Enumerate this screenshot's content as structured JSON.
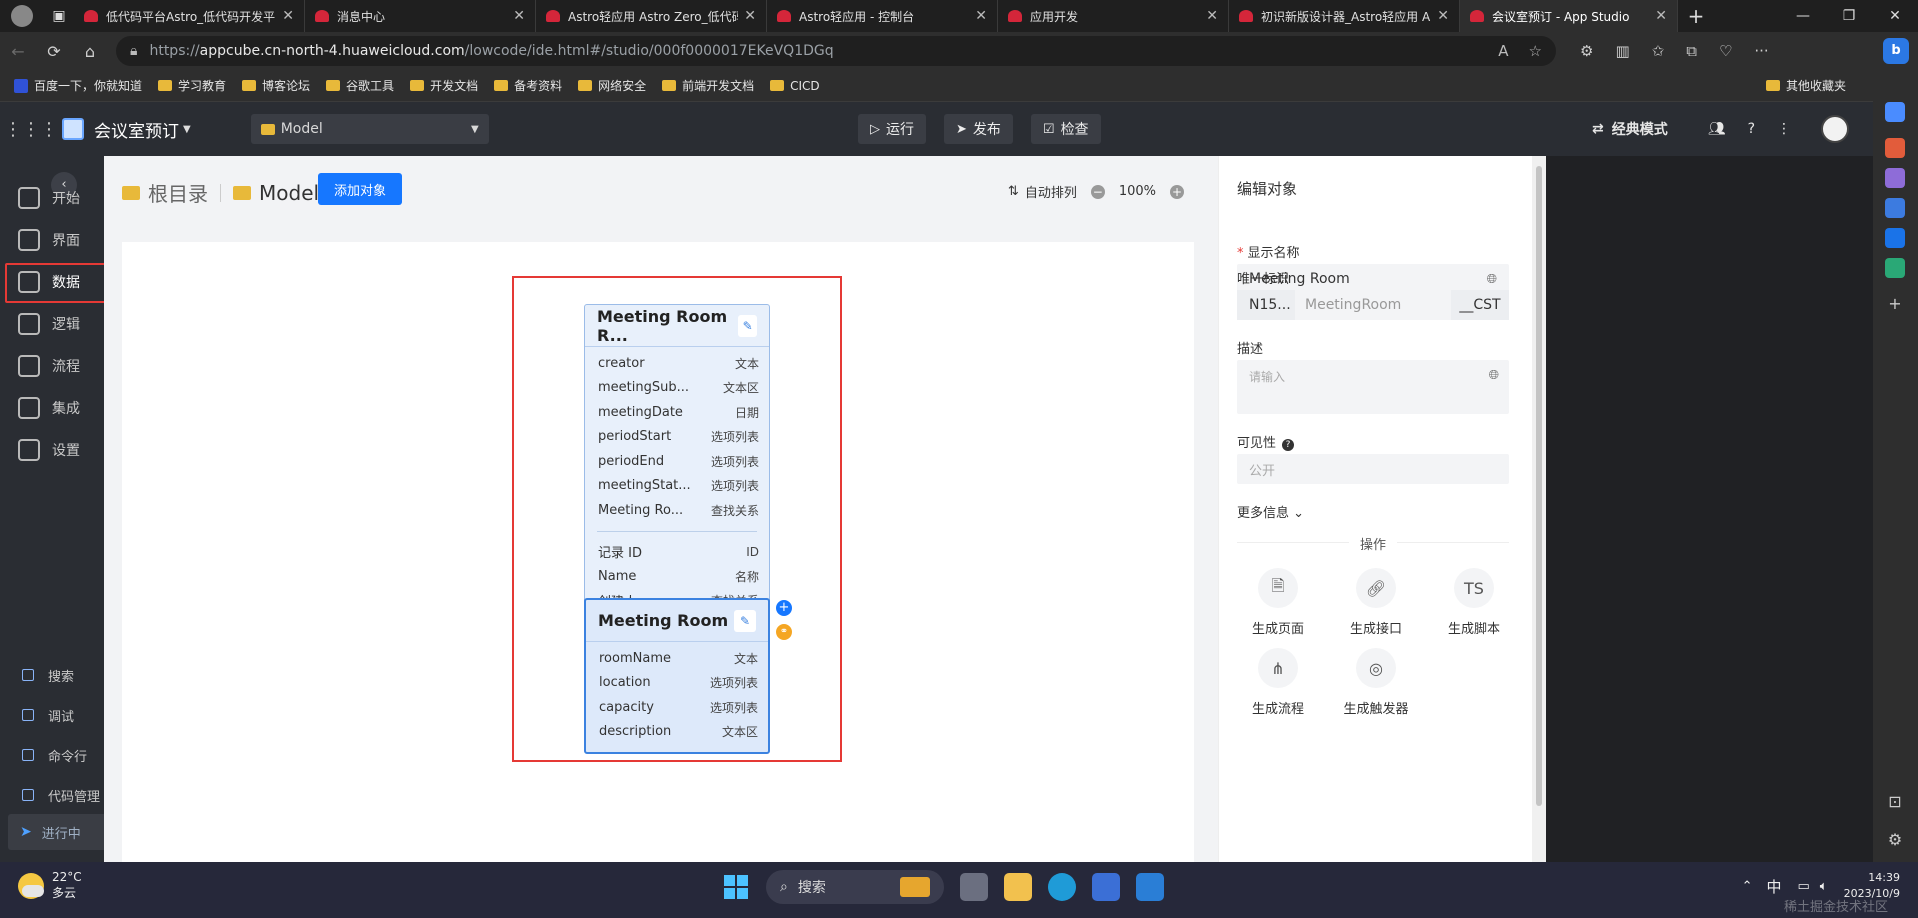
{
  "browser": {
    "tabs": [
      {
        "title": "低代码平台Astro_低代码开发平"
      },
      {
        "title": "消息中心"
      },
      {
        "title": "Astro轻应用 Astro Zero_低代码"
      },
      {
        "title": "Astro轻应用 - 控制台"
      },
      {
        "title": "应用开发"
      },
      {
        "title": "初识新版设计器_Astro轻应用 A"
      },
      {
        "title": "会议室预订 - App Studio"
      }
    ],
    "url_prefix": "https://",
    "url_host": "appcube.cn-north-4.huaweicloud.com",
    "url_path": "/lowcode/ide.html#/studio/000f0000017EKeVQ1DGq",
    "bookmarks": [
      "百度一下，你就知道",
      "学习教育",
      "博客论坛",
      "谷歌工具",
      "开发文档",
      "备考资料",
      "网络安全",
      "前端开发文档",
      "CICD"
    ],
    "bookmark_right": "其他收藏夹"
  },
  "app": {
    "name": "会议室预订",
    "model_select": "Model",
    "run_label": "运行",
    "publish_label": "发布",
    "check_label": "检查",
    "mode_label": "经典模式"
  },
  "sidebar": {
    "items": [
      {
        "label": "开始"
      },
      {
        "label": "界面"
      },
      {
        "label": "数据"
      },
      {
        "label": "逻辑"
      },
      {
        "label": "流程"
      },
      {
        "label": "集成"
      },
      {
        "label": "设置"
      }
    ],
    "tools": [
      {
        "label": "搜索"
      },
      {
        "label": "调试"
      },
      {
        "label": "命令行"
      },
      {
        "label": "代码管理"
      }
    ],
    "running_label": "进行中"
  },
  "canvas": {
    "breadcrumb_root": "根目录",
    "breadcrumb_current": "Model",
    "add_object_label": "添加对象",
    "auto_arrange_label": "自动排列",
    "zoom_level": "100%"
  },
  "entities": [
    {
      "title": "Meeting Room R...",
      "fields": [
        {
          "name": "creator",
          "type": "文本"
        },
        {
          "name": "meetingSub...",
          "type": "文本区"
        },
        {
          "name": "meetingDate",
          "type": "日期"
        },
        {
          "name": "periodStart",
          "type": "选项列表"
        },
        {
          "name": "periodEnd",
          "type": "选项列表"
        },
        {
          "name": "meetingStat...",
          "type": "选项列表"
        },
        {
          "name": "Meeting Ro...",
          "type": "查找关系"
        }
      ],
      "system_fields": [
        {
          "name": "记录 ID",
          "type": "ID"
        },
        {
          "name": "Name",
          "type": "名称"
        },
        {
          "name": "创建人",
          "type": "查找关系"
        }
      ]
    },
    {
      "title": "Meeting Room",
      "fields": [
        {
          "name": "roomName",
          "type": "文本"
        },
        {
          "name": "location",
          "type": "选项列表"
        },
        {
          "name": "capacity",
          "type": "选项列表"
        },
        {
          "name": "description",
          "type": "文本区"
        }
      ]
    }
  ],
  "panel": {
    "title": "编辑对象",
    "display_name_label": "显示名称",
    "display_name_value": "Meeting Room",
    "unique_id_label": "唯一标识",
    "unique_id_prefix": "N15...",
    "unique_id_placeholder": "MeetingRoom",
    "unique_id_suffix": "__CST",
    "description_label": "描述",
    "description_placeholder": "请输入",
    "visibility_label": "可见性",
    "visibility_value": "公开",
    "more_info_label": "更多信息",
    "operations_label": "操作",
    "actions": [
      {
        "label": "生成页面",
        "icon": "page-icon"
      },
      {
        "label": "生成接口",
        "icon": "link-icon"
      },
      {
        "label": "生成脚本",
        "icon": "script-icon"
      },
      {
        "label": "生成流程",
        "icon": "flow-icon"
      },
      {
        "label": "生成触发器",
        "icon": "trigger-icon"
      }
    ]
  },
  "taskbar": {
    "temperature": "22°C",
    "weather": "多云",
    "search_label": "搜索",
    "ime": "中",
    "time": "14:39",
    "date": "2023/10/9",
    "watermark": "稀土掘金技术社区"
  }
}
